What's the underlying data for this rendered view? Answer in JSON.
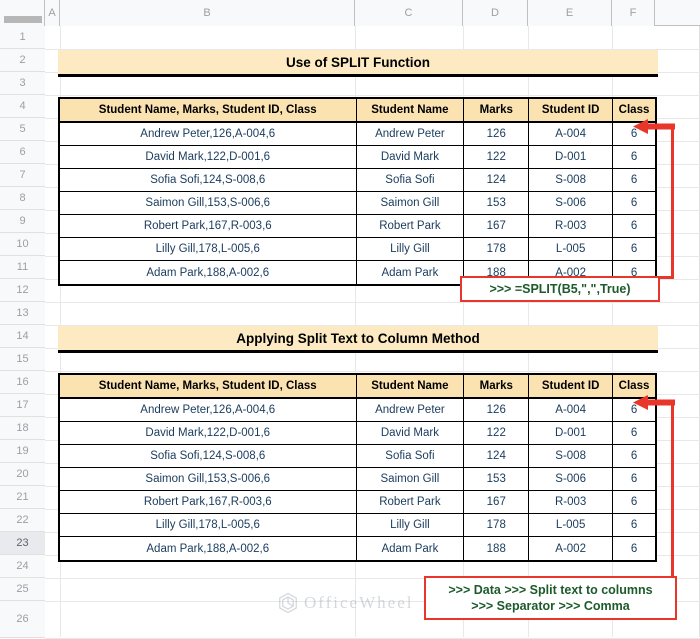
{
  "spreadsheet": {
    "column_headers": [
      "A",
      "B",
      "C",
      "D",
      "E",
      "F"
    ],
    "row_numbers": [
      "1",
      "2",
      "3",
      "4",
      "5",
      "6",
      "7",
      "8",
      "9",
      "10",
      "11",
      "12",
      "13",
      "14",
      "15",
      "16",
      "17",
      "18",
      "19",
      "20",
      "21",
      "22",
      "23",
      "24",
      "25",
      "26"
    ],
    "selected_row": "23",
    "colors": {
      "title_fill": "#FDEAC3",
      "header_fill": "#FBE2B1",
      "callout_border": "#E8362A",
      "callout_text": "#1D5B2B",
      "cell_text": "#1A3B5C",
      "grid_line": "#E8E8E8"
    }
  },
  "section1": {
    "title": "Use of SPLIT Function",
    "columns": [
      "Student Name, Marks, Student ID, Class",
      "Student Name",
      "Marks",
      "Student ID",
      "Class"
    ],
    "rows": [
      [
        "Andrew Peter,126,A-004,6",
        "Andrew Peter",
        "126",
        "A-004",
        "6"
      ],
      [
        "David Mark,122,D-001,6",
        "David Mark",
        "122",
        "D-001",
        "6"
      ],
      [
        "Sofia Sofi,124,S-008,6",
        "Sofia Sofi",
        "124",
        "S-008",
        "6"
      ],
      [
        "Saimon Gill,153,S-006,6",
        "Saimon Gill",
        "153",
        "S-006",
        "6"
      ],
      [
        "Robert Park,167,R-003,6",
        "Robert Park",
        "167",
        "R-003",
        "6"
      ],
      [
        "Lilly Gill,178,L-005,6",
        "Lilly Gill",
        "178",
        "L-005",
        "6"
      ],
      [
        "Adam Park,188,A-002,6",
        "Adam Park",
        "188",
        "A-002",
        "6"
      ]
    ],
    "callout": ">>> =SPLIT(B5,\",\",True)"
  },
  "section2": {
    "title": "Applying Split Text to Column Method",
    "columns": [
      "Student Name, Marks, Student ID, Class",
      "Student Name",
      "Marks",
      "Student ID",
      "Class"
    ],
    "rows": [
      [
        "Andrew Peter,126,A-004,6",
        "Andrew Peter",
        "126",
        "A-004",
        "6"
      ],
      [
        "David Mark,122,D-001,6",
        "David Mark",
        "122",
        "D-001",
        "6"
      ],
      [
        "Sofia Sofi,124,S-008,6",
        "Sofia Sofi",
        "124",
        "S-008",
        "6"
      ],
      [
        "Saimon Gill,153,S-006,6",
        "Saimon Gill",
        "153",
        "S-006",
        "6"
      ],
      [
        "Robert Park,167,R-003,6",
        "Robert Park",
        "167",
        "R-003",
        "6"
      ],
      [
        "Lilly Gill,178,L-005,6",
        "Lilly Gill",
        "178",
        "L-005",
        "6"
      ],
      [
        "Adam Park,188,A-002,6",
        "Adam Park",
        "188",
        "A-002",
        "6"
      ]
    ],
    "callout_line1": ">>> Data >>> Split text to columns",
    "callout_line2": ">>> Separator >>> Comma"
  },
  "watermark": {
    "text": "OfficeWheel"
  }
}
